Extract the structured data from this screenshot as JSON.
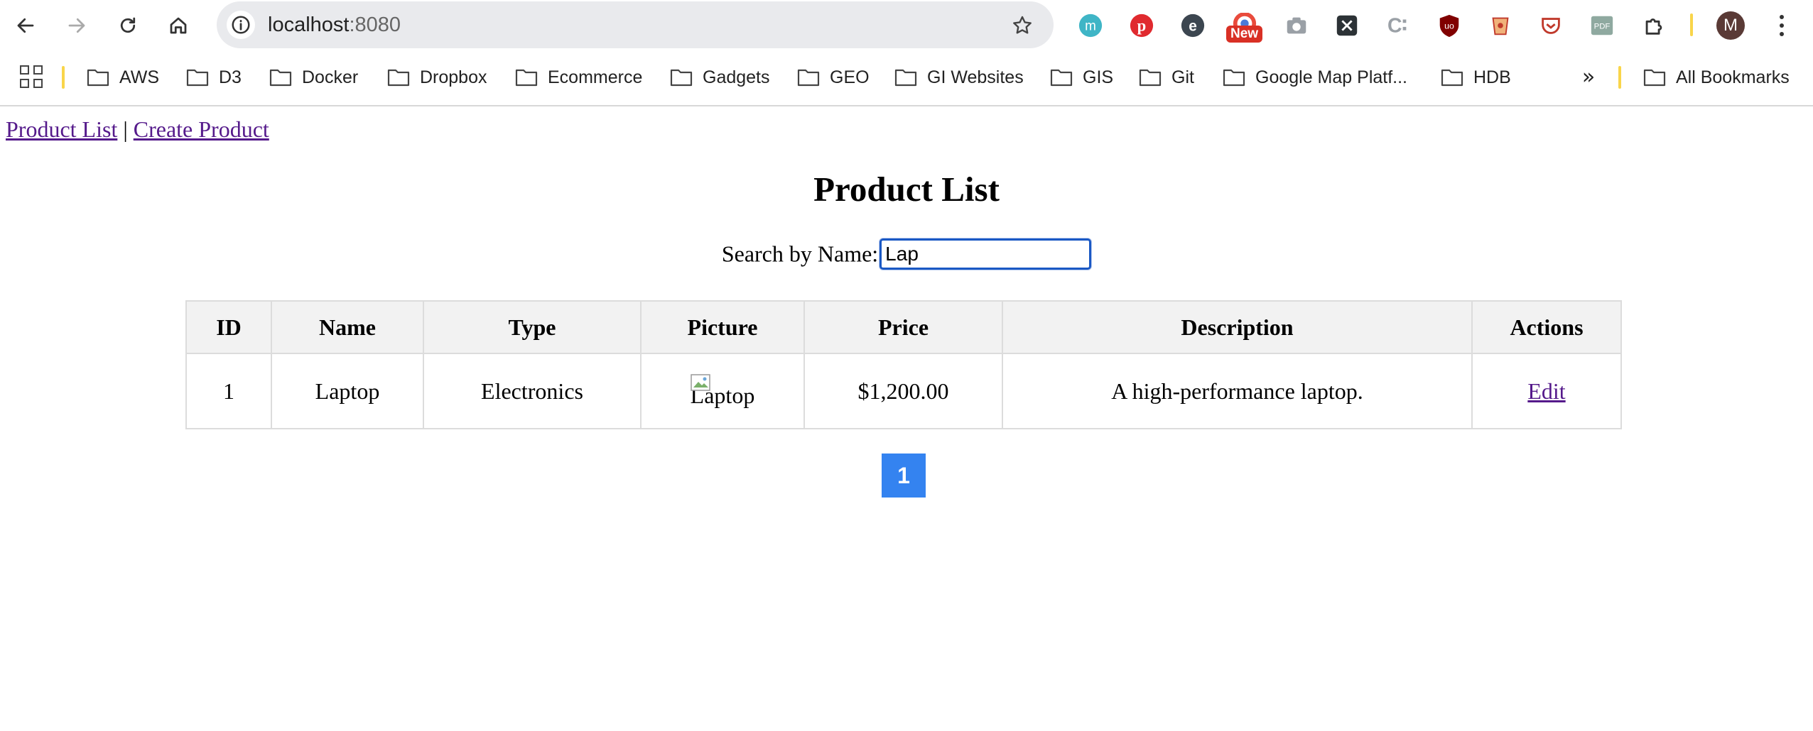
{
  "browser": {
    "url_host": "localhost",
    "url_port": ":8080",
    "extension_badge": "New",
    "avatar_letter": "M",
    "extensions": [
      "meet-m-icon",
      "pinterest-icon",
      "e-extension-icon",
      "colorful-extension-icon",
      "camera-icon",
      "x-extension-icon",
      "c-extension-icon",
      "ublock-icon",
      "cup-icon",
      "pocket-icon",
      "pdf-icon",
      "puzzle-icon"
    ]
  },
  "bookmarks": {
    "items": [
      "AWS",
      "D3",
      "Docker",
      "Dropbox",
      "Ecommerce",
      "Gadgets",
      "GEO",
      "GI Websites",
      "GIS",
      "Git",
      "Google Map Platf...",
      "HDB"
    ],
    "more": "»",
    "all_bookmarks": "All Bookmarks"
  },
  "page": {
    "nav": {
      "product_list": "Product List",
      "separator": "|",
      "create_product": "Create Product"
    },
    "title": "Product List",
    "search": {
      "label": "Search by Name:",
      "value": "Lap"
    },
    "table": {
      "headers": [
        "ID",
        "Name",
        "Type",
        "Picture",
        "Price",
        "Description",
        "Actions"
      ],
      "rows": [
        {
          "id": "1",
          "name": "Laptop",
          "type": "Electronics",
          "picture_alt": "Laptop",
          "price": "$1,200.00",
          "description": "A high-performance laptop.",
          "action": "Edit"
        }
      ]
    },
    "pagination": {
      "pages": [
        "1"
      ],
      "current": "1"
    }
  },
  "colors": {
    "accent": "#3483f0",
    "visited_link": "#551a8b",
    "focus_border": "#1a58c4",
    "header_bg": "#f2f2f2"
  }
}
